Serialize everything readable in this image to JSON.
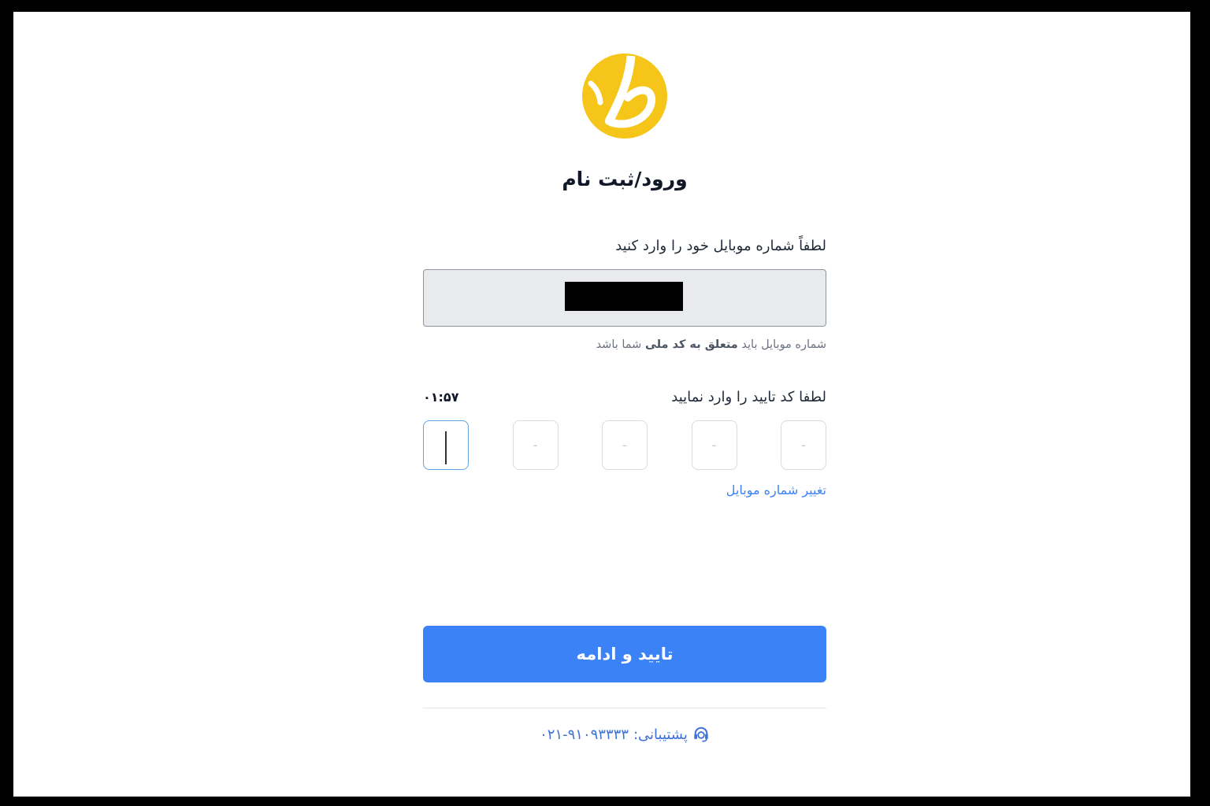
{
  "colors": {
    "brand_yellow": "#f6c519",
    "primary": "#3b82f6",
    "focus_border": "#66a3dd",
    "text": "#1f2937",
    "muted": "#6b7280",
    "input_bg": "#e8eaed"
  },
  "logo": {
    "icon": "yellow-circle-letter-ta-logo"
  },
  "title": "ورود/ثبت نام",
  "phone": {
    "label": "لطفاً شماره موبایل خود را وارد کنید",
    "hint": {
      "prefix": "شماره موبایل باید",
      "bold": "متعلق به کد ملی",
      "suffix": "شما باشد"
    }
  },
  "otp": {
    "label": "لطفا کد تایید را وارد نمایید",
    "timer": "۰۱:۵۷",
    "active_box": 1,
    "boxes": [
      {
        "placeholder": ""
      },
      {
        "placeholder": "-"
      },
      {
        "placeholder": "-"
      },
      {
        "placeholder": "-"
      },
      {
        "placeholder": "-"
      }
    ]
  },
  "change_number_link": "تغییر شماره موبایل",
  "submit_button": "تایید و ادامه",
  "support": {
    "icon": "headset-icon",
    "label": "پشتیبانی:",
    "phone": "۰۲۱-۹۱۰۹۳۳۳۳"
  }
}
